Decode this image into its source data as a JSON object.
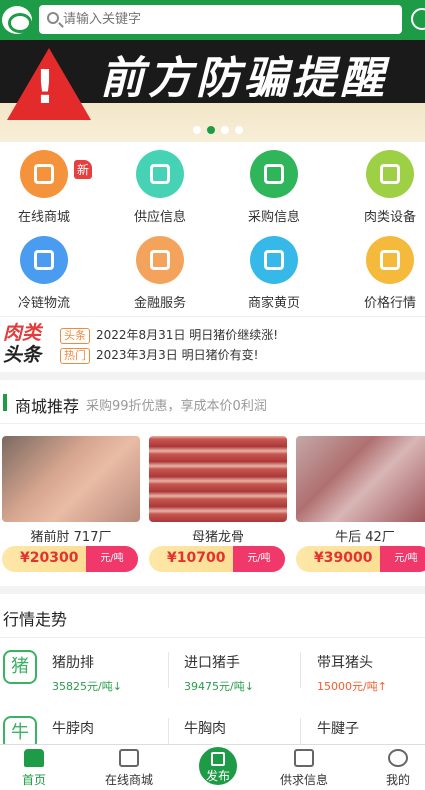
{
  "search": {
    "placeholder": "请输入关键字"
  },
  "banner": {
    "title": "前方防骗提醒",
    "warning_mark": "!"
  },
  "grid": [
    {
      "label": "在线商城",
      "icon": "store-icon",
      "color": "#f5933c",
      "badge": "新"
    },
    {
      "label": "供应信息",
      "icon": "supply-icon",
      "color": "#46d3b5"
    },
    {
      "label": "采购信息",
      "icon": "basket-icon",
      "color": "#2fb55a"
    },
    {
      "label": "肉类设备",
      "icon": "equipment-icon",
      "color": "#9ed046"
    },
    {
      "label": "冷链物流",
      "icon": "truck-icon",
      "color": "#4a9cf0"
    },
    {
      "label": "金融服务",
      "icon": "finance-icon",
      "color": "#f4a35c"
    },
    {
      "label": "商家黄页",
      "icon": "phone-book-icon",
      "color": "#36b9e8"
    },
    {
      "label": "价格行情",
      "icon": "chart-icon",
      "color": "#f5b93c"
    }
  ],
  "news": {
    "logo_line1": "肉类",
    "logo_line2": "头条",
    "items": [
      {
        "tag": "头条",
        "text": "2022年8月31日 明日猪价继续涨!"
      },
      {
        "tag": "热门",
        "text": "2023年3月3日 明日猪价有变!"
      }
    ]
  },
  "mall": {
    "title": "商城推荐",
    "subtitle": "采购99折优惠，享成本价0利润",
    "products": [
      {
        "name": "猪前肘 717厂",
        "price": "¥20300",
        "unit": "元/吨"
      },
      {
        "name": "母猪龙骨",
        "price": "¥10700",
        "unit": "元/吨"
      },
      {
        "name": "牛后 42厂",
        "price": "¥39000",
        "unit": "元/吨"
      }
    ]
  },
  "market": {
    "title": "行情走势",
    "rows": [
      {
        "badge": "猪",
        "items": [
          {
            "name": "猪肋排",
            "price": "35825元/吨",
            "trend": "down",
            "arrow": "↓"
          },
          {
            "name": "进口猪手",
            "price": "39475元/吨",
            "trend": "down",
            "arrow": "↓"
          },
          {
            "name": "带耳猪头",
            "price": "15000元/吨",
            "trend": "up",
            "arrow": "↑"
          }
        ]
      },
      {
        "badge": "牛",
        "items": [
          {
            "name": "牛脖肉",
            "price": "",
            "trend": "",
            "arrow": ""
          },
          {
            "name": "牛胸肉",
            "price": "",
            "trend": "",
            "arrow": ""
          },
          {
            "name": "牛腱子",
            "price": "",
            "trend": "",
            "arrow": ""
          }
        ]
      }
    ]
  },
  "tabbar": {
    "home": "首页",
    "mall": "在线商城",
    "publish": "发布",
    "supply": "供求信息",
    "mine": "我的"
  },
  "colors": {
    "brand": "#1e9b46",
    "price_red": "#e5322e",
    "unit_pink": "#f1386a"
  }
}
